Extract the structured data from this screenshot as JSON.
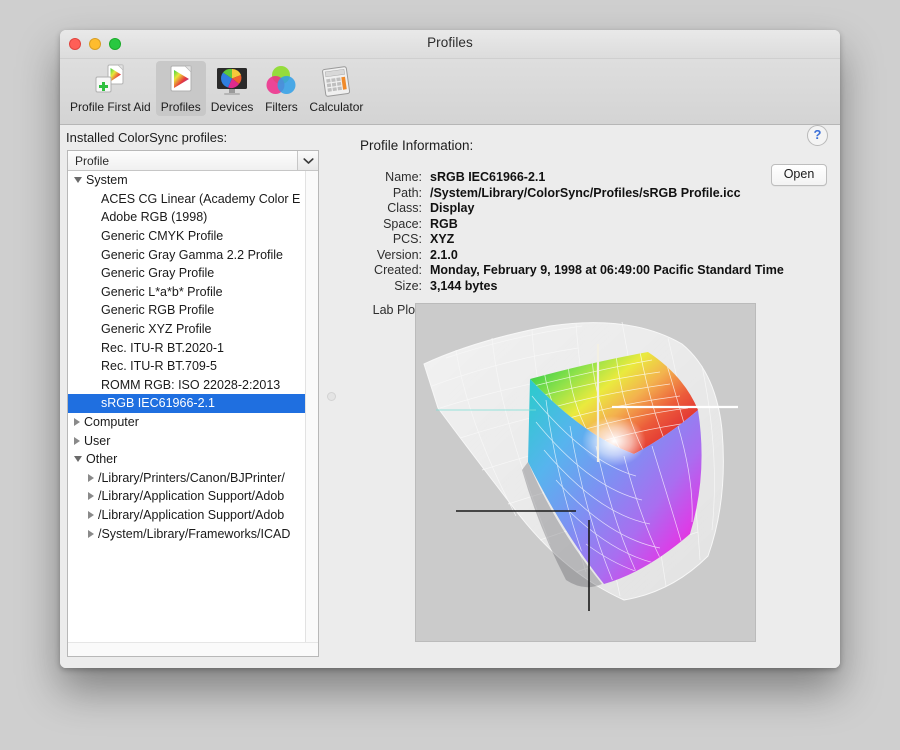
{
  "window": {
    "title": "Profiles",
    "traffic_lights": [
      {
        "name": "close",
        "color": "#ff5f57"
      },
      {
        "name": "minimize",
        "color": "#febc2e"
      },
      {
        "name": "zoom",
        "color": "#28c840"
      }
    ]
  },
  "toolbar": {
    "items": [
      {
        "id": "profile-first-aid",
        "label": "Profile First Aid",
        "icon": "profile-first-aid-icon",
        "selected": false
      },
      {
        "id": "profiles",
        "label": "Profiles",
        "icon": "profiles-icon",
        "selected": true
      },
      {
        "id": "devices",
        "label": "Devices",
        "icon": "devices-icon",
        "selected": false
      },
      {
        "id": "filters",
        "label": "Filters",
        "icon": "filters-icon",
        "selected": false
      },
      {
        "id": "calculator",
        "label": "Calculator",
        "icon": "calculator-icon",
        "selected": false
      }
    ]
  },
  "sidebar": {
    "heading": "Installed ColorSync profiles:",
    "column_header": "Profile",
    "header_menu_icon": "chevron-down-icon",
    "rows": [
      {
        "label": "System",
        "indent": 0,
        "twisty": "down",
        "selected": false
      },
      {
        "label": "ACES CG Linear (Academy Color E",
        "indent": 1,
        "twisty": "none",
        "selected": false
      },
      {
        "label": "Adobe RGB (1998)",
        "indent": 1,
        "twisty": "none",
        "selected": false
      },
      {
        "label": "Generic CMYK Profile",
        "indent": 1,
        "twisty": "none",
        "selected": false
      },
      {
        "label": "Generic Gray Gamma 2.2 Profile",
        "indent": 1,
        "twisty": "none",
        "selected": false
      },
      {
        "label": "Generic Gray Profile",
        "indent": 1,
        "twisty": "none",
        "selected": false
      },
      {
        "label": "Generic L*a*b* Profile",
        "indent": 1,
        "twisty": "none",
        "selected": false
      },
      {
        "label": "Generic RGB Profile",
        "indent": 1,
        "twisty": "none",
        "selected": false
      },
      {
        "label": "Generic XYZ Profile",
        "indent": 1,
        "twisty": "none",
        "selected": false
      },
      {
        "label": "Rec. ITU-R BT.2020-1",
        "indent": 1,
        "twisty": "none",
        "selected": false
      },
      {
        "label": "Rec. ITU-R BT.709-5",
        "indent": 1,
        "twisty": "none",
        "selected": false
      },
      {
        "label": "ROMM RGB: ISO 22028-2:2013",
        "indent": 1,
        "twisty": "none",
        "selected": false
      },
      {
        "label": "sRGB IEC61966-2.1",
        "indent": 1,
        "twisty": "none",
        "selected": true
      },
      {
        "label": "Computer",
        "indent": 0,
        "twisty": "right",
        "selected": false
      },
      {
        "label": "User",
        "indent": 0,
        "twisty": "right",
        "selected": false
      },
      {
        "label": "Other",
        "indent": 0,
        "twisty": "down",
        "selected": false
      },
      {
        "label": "/Library/Printers/Canon/BJPrinter/",
        "indent": 1,
        "twisty": "right",
        "selected": false
      },
      {
        "label": "/Library/Application Support/Adob",
        "indent": 1,
        "twisty": "right",
        "selected": false
      },
      {
        "label": "/Library/Application Support/Adob",
        "indent": 1,
        "twisty": "right",
        "selected": false
      },
      {
        "label": "/System/Library/Frameworks/ICAD",
        "indent": 1,
        "twisty": "right",
        "selected": false
      }
    ]
  },
  "info": {
    "heading": "Profile Information:",
    "help_label": "?",
    "open_label": "Open",
    "fields": [
      {
        "key": "Name:",
        "value": "sRGB IEC61966-2.1"
      },
      {
        "key": "Path:",
        "value": "/System/Library/ColorSync/Profiles/sRGB Profile.icc"
      },
      {
        "key": "Class:",
        "value": "Display"
      },
      {
        "key": "Space:",
        "value": "RGB"
      },
      {
        "key": "PCS:",
        "value": "XYZ"
      },
      {
        "key": "Version:",
        "value": "2.1.0"
      },
      {
        "key": "Created:",
        "value": "Monday, February 9, 1998 at 06:49:00 Pacific Standard Time"
      },
      {
        "key": "Size:",
        "value": "3,144 bytes"
      }
    ],
    "lab_plot_key": "Lab Plot:",
    "lab_plot_disclosure_icon": "triangle-down-icon"
  },
  "colors": {
    "selection_blue": "#1f6fe0",
    "window_chrome": "#ececec",
    "plot_background": "#cbcbcb",
    "help_blue": "#3a6fd8"
  },
  "chart_data": {
    "type": "scatter",
    "title": "Lab Plot",
    "description": "3D L*a*b* gamut surface of the sRGB IEC61966-2.1 display profile shown as a colored mesh, overlaid on a translucent white reference gamut wireframe, with black L* and a* axis lines.",
    "axes": [
      "L*",
      "a*",
      "b*"
    ],
    "grid": true,
    "legend": false,
    "series": [
      {
        "name": "sRGB gamut surface",
        "color": "#multicolor"
      },
      {
        "name": "Reference gamut wireframe",
        "color": "#ffffff"
      }
    ],
    "gamut_corner_colors": {
      "green": "#38d24a",
      "yellow": "#f2ee3a",
      "orange": "#f0a54e",
      "red": "#e8402f",
      "magenta": "#f02ad1",
      "violet": "#7a35e8",
      "blue": "#2f6be8",
      "cyan": "#32c8d8",
      "white": "#ffffff"
    }
  }
}
